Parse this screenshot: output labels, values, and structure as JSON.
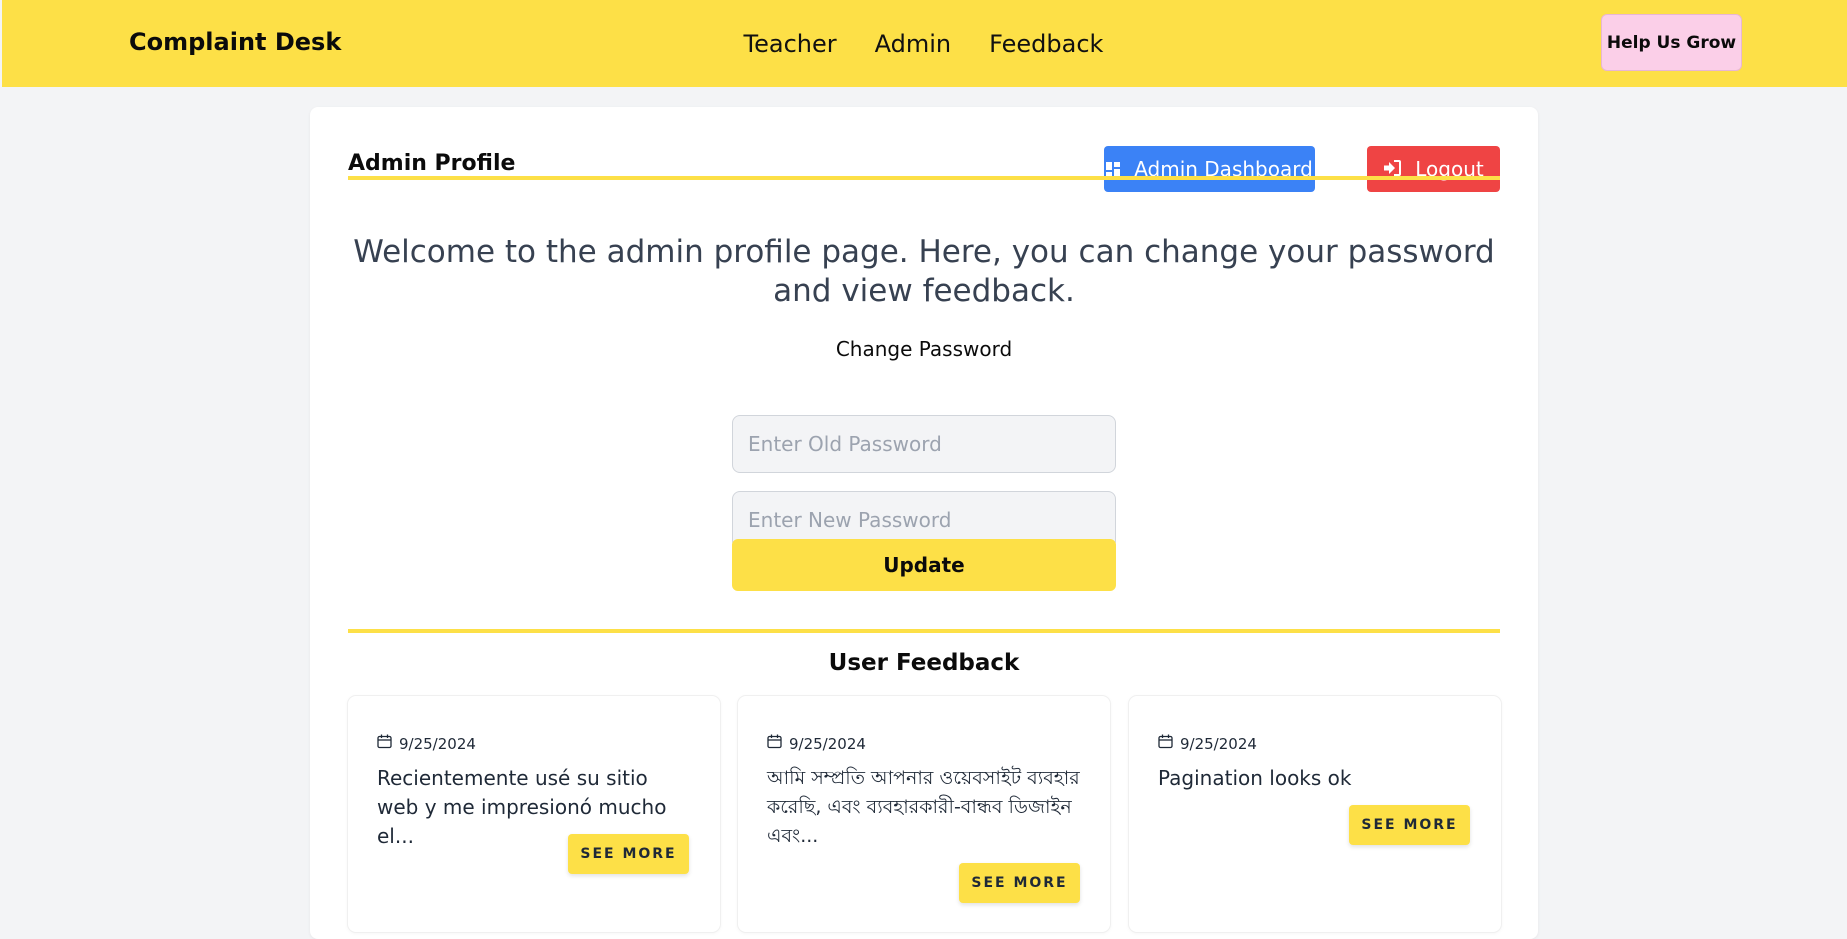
{
  "navbar": {
    "brand": "Complaint Desk",
    "links": [
      "Teacher",
      "Admin",
      "Feedback"
    ],
    "help_button": "Help Us Grow"
  },
  "profile": {
    "title": "Admin Profile",
    "dashboard_button": "Admin Dashboard",
    "logout_button": "Logout",
    "welcome": "Welcome to the admin profile page. Here, you can change your password and view feedback."
  },
  "password_form": {
    "label": "Change Password",
    "old_placeholder": "Enter Old Password",
    "new_placeholder": "Enter New Password",
    "update_button": "Update"
  },
  "feedback": {
    "heading": "User Feedback",
    "see_more_label": "SEE MORE",
    "items": [
      {
        "date": "9/25/2024",
        "text": "Recientemente usé su sitio web y me impresionó mucho el..."
      },
      {
        "date": "9/25/2024",
        "text": "আমি সম্প্রতি আপনার ওয়েবসাইট ব্যবহার করেছি, এবং ব্যবহারকারী-বান্ধব ডিজাইন এবং..."
      },
      {
        "date": "9/25/2024",
        "text": "Pagination looks ok"
      }
    ]
  },
  "colors": {
    "accent_yellow": "#fde047",
    "help_pink": "#fbcfe8",
    "dashboard_blue": "#3b82f6",
    "logout_red": "#ef4444"
  }
}
